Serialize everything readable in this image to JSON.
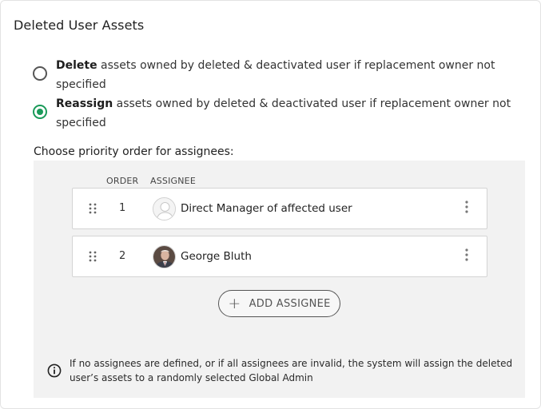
{
  "section": {
    "title": "Deleted User Assets"
  },
  "options": [
    {
      "bold": "Delete",
      "text": " assets owned by deleted & deactivated user if replacement owner not specified",
      "checked": false
    },
    {
      "bold": "Reassign",
      "text": " assets owned by deleted & deactivated user if replacement owner not specified",
      "checked": true
    }
  ],
  "priority": {
    "label": "Choose priority order for assignees:",
    "columns": {
      "order": "ORDER",
      "assignee": "ASSIGNEE"
    },
    "rows": [
      {
        "order": "1",
        "name": "Direct Manager of affected user",
        "avatar_icon": "default-user-icon"
      },
      {
        "order": "2",
        "name": "George Bluth",
        "avatar_icon": "user-photo-icon"
      }
    ],
    "add_button": "ADD ASSIGNEE",
    "info": "If no assignees are defined, or if all assignees are invalid, the system will assign the deleted user’s assets to a randomly selected Global Admin"
  },
  "colors": {
    "accent": "#1a9a59",
    "panel_bg": "#f2f2f2"
  }
}
